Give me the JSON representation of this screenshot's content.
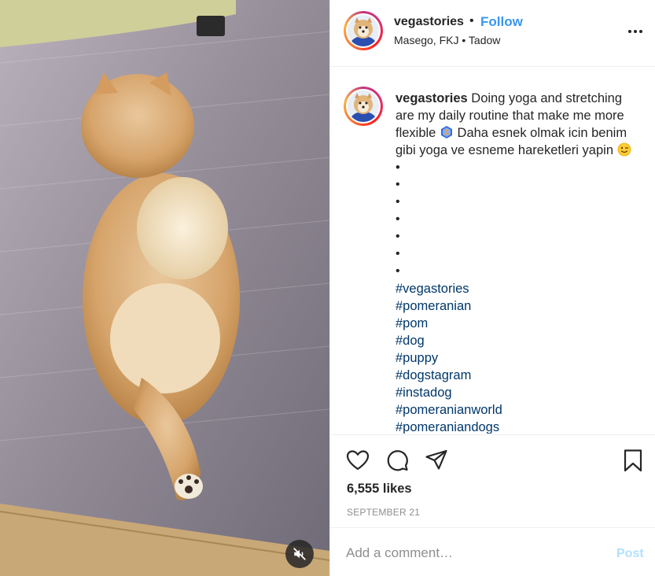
{
  "media": {
    "alt_icon": "pomeranian-dog-video",
    "mute_icon": "speaker-muted-icon"
  },
  "header": {
    "username": "vegastories",
    "separator": "•",
    "follow_label": "Follow",
    "location": "Masego, FKJ • Tadow",
    "more_icon": "more-options-icon"
  },
  "caption": {
    "username": "vegastories",
    "text_before_emoji1": " Doing yoga and stretching are my daily routine that make me more flexible ",
    "emoji1": "yoga-emoji",
    "text_before_emoji2": " Daha esnek olmak icin benim gibi yoga ve esneme hareketleri yapin ",
    "emoji2": "wink-emoji",
    "text_after_emoji2": " •",
    "bullets": [
      "•",
      "•",
      "•",
      "•",
      "•",
      "•"
    ],
    "hashtags": [
      "#vegastories",
      "#pomeranian",
      "#pom",
      "#dog",
      "#puppy",
      "#dogstagram",
      "#instadog",
      "#pomeranianworld",
      "#pomeraniandogs"
    ]
  },
  "actions": {
    "like_icon": "heart-icon",
    "comment_icon": "comment-bubble-icon",
    "share_icon": "paper-plane-icon",
    "save_icon": "bookmark-icon",
    "likes": "6,555 likes",
    "date": "SEPTEMBER 21"
  },
  "comment": {
    "placeholder": "Add a comment…",
    "post_label": "Post"
  },
  "colors": {
    "link_blue": "#3897f0",
    "hashtag": "#00376b",
    "post_disabled": "#b2dffc",
    "muted_text": "#8e8e8e"
  }
}
